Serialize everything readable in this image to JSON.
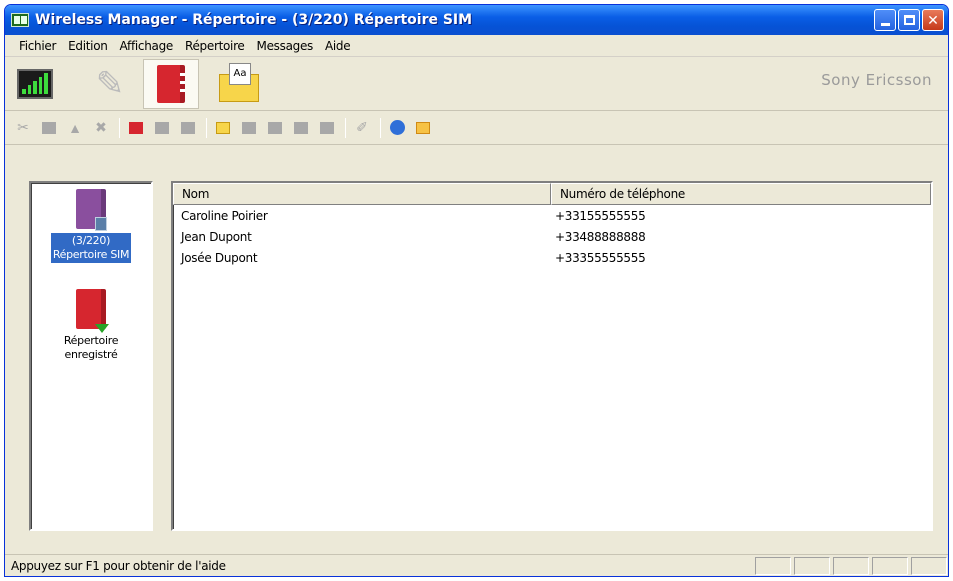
{
  "window": {
    "title": "Wireless Manager - Répertoire - (3/220) Répertoire SIM",
    "controls": [
      "minimize-icon",
      "maximize-icon",
      "close-icon"
    ]
  },
  "menu": [
    "Fichier",
    "Edition",
    "Affichage",
    "Répertoire",
    "Messages",
    "Aide"
  ],
  "brand": "Sony Ericsson",
  "mail_icon_text": "Aa",
  "nav": {
    "items": [
      {
        "label_line1": "(3/220)",
        "label_line2": "Répertoire SIM",
        "icon": "sim-phonebook-icon",
        "selected": true
      },
      {
        "label_line1": "Répertoire",
        "label_line2": "enregistré",
        "icon": "saved-phonebook-icon",
        "selected": false
      }
    ]
  },
  "list": {
    "columns": [
      "Nom",
      "Numéro de téléphone"
    ],
    "rows": [
      {
        "name": "Caroline Poirier",
        "phone": "+33155555555"
      },
      {
        "name": "Jean Dupont",
        "phone": "+33488888888"
      },
      {
        "name": "Josée Dupont",
        "phone": "+33355555555"
      }
    ]
  },
  "status": {
    "text": "Appuyez sur F1 pour obtenir de l'aide"
  },
  "colors": {
    "titlebar": "#0a5ee6",
    "selection": "#316ac5",
    "accent_red": "#d6262f",
    "window_bg": "#ece9d8"
  }
}
